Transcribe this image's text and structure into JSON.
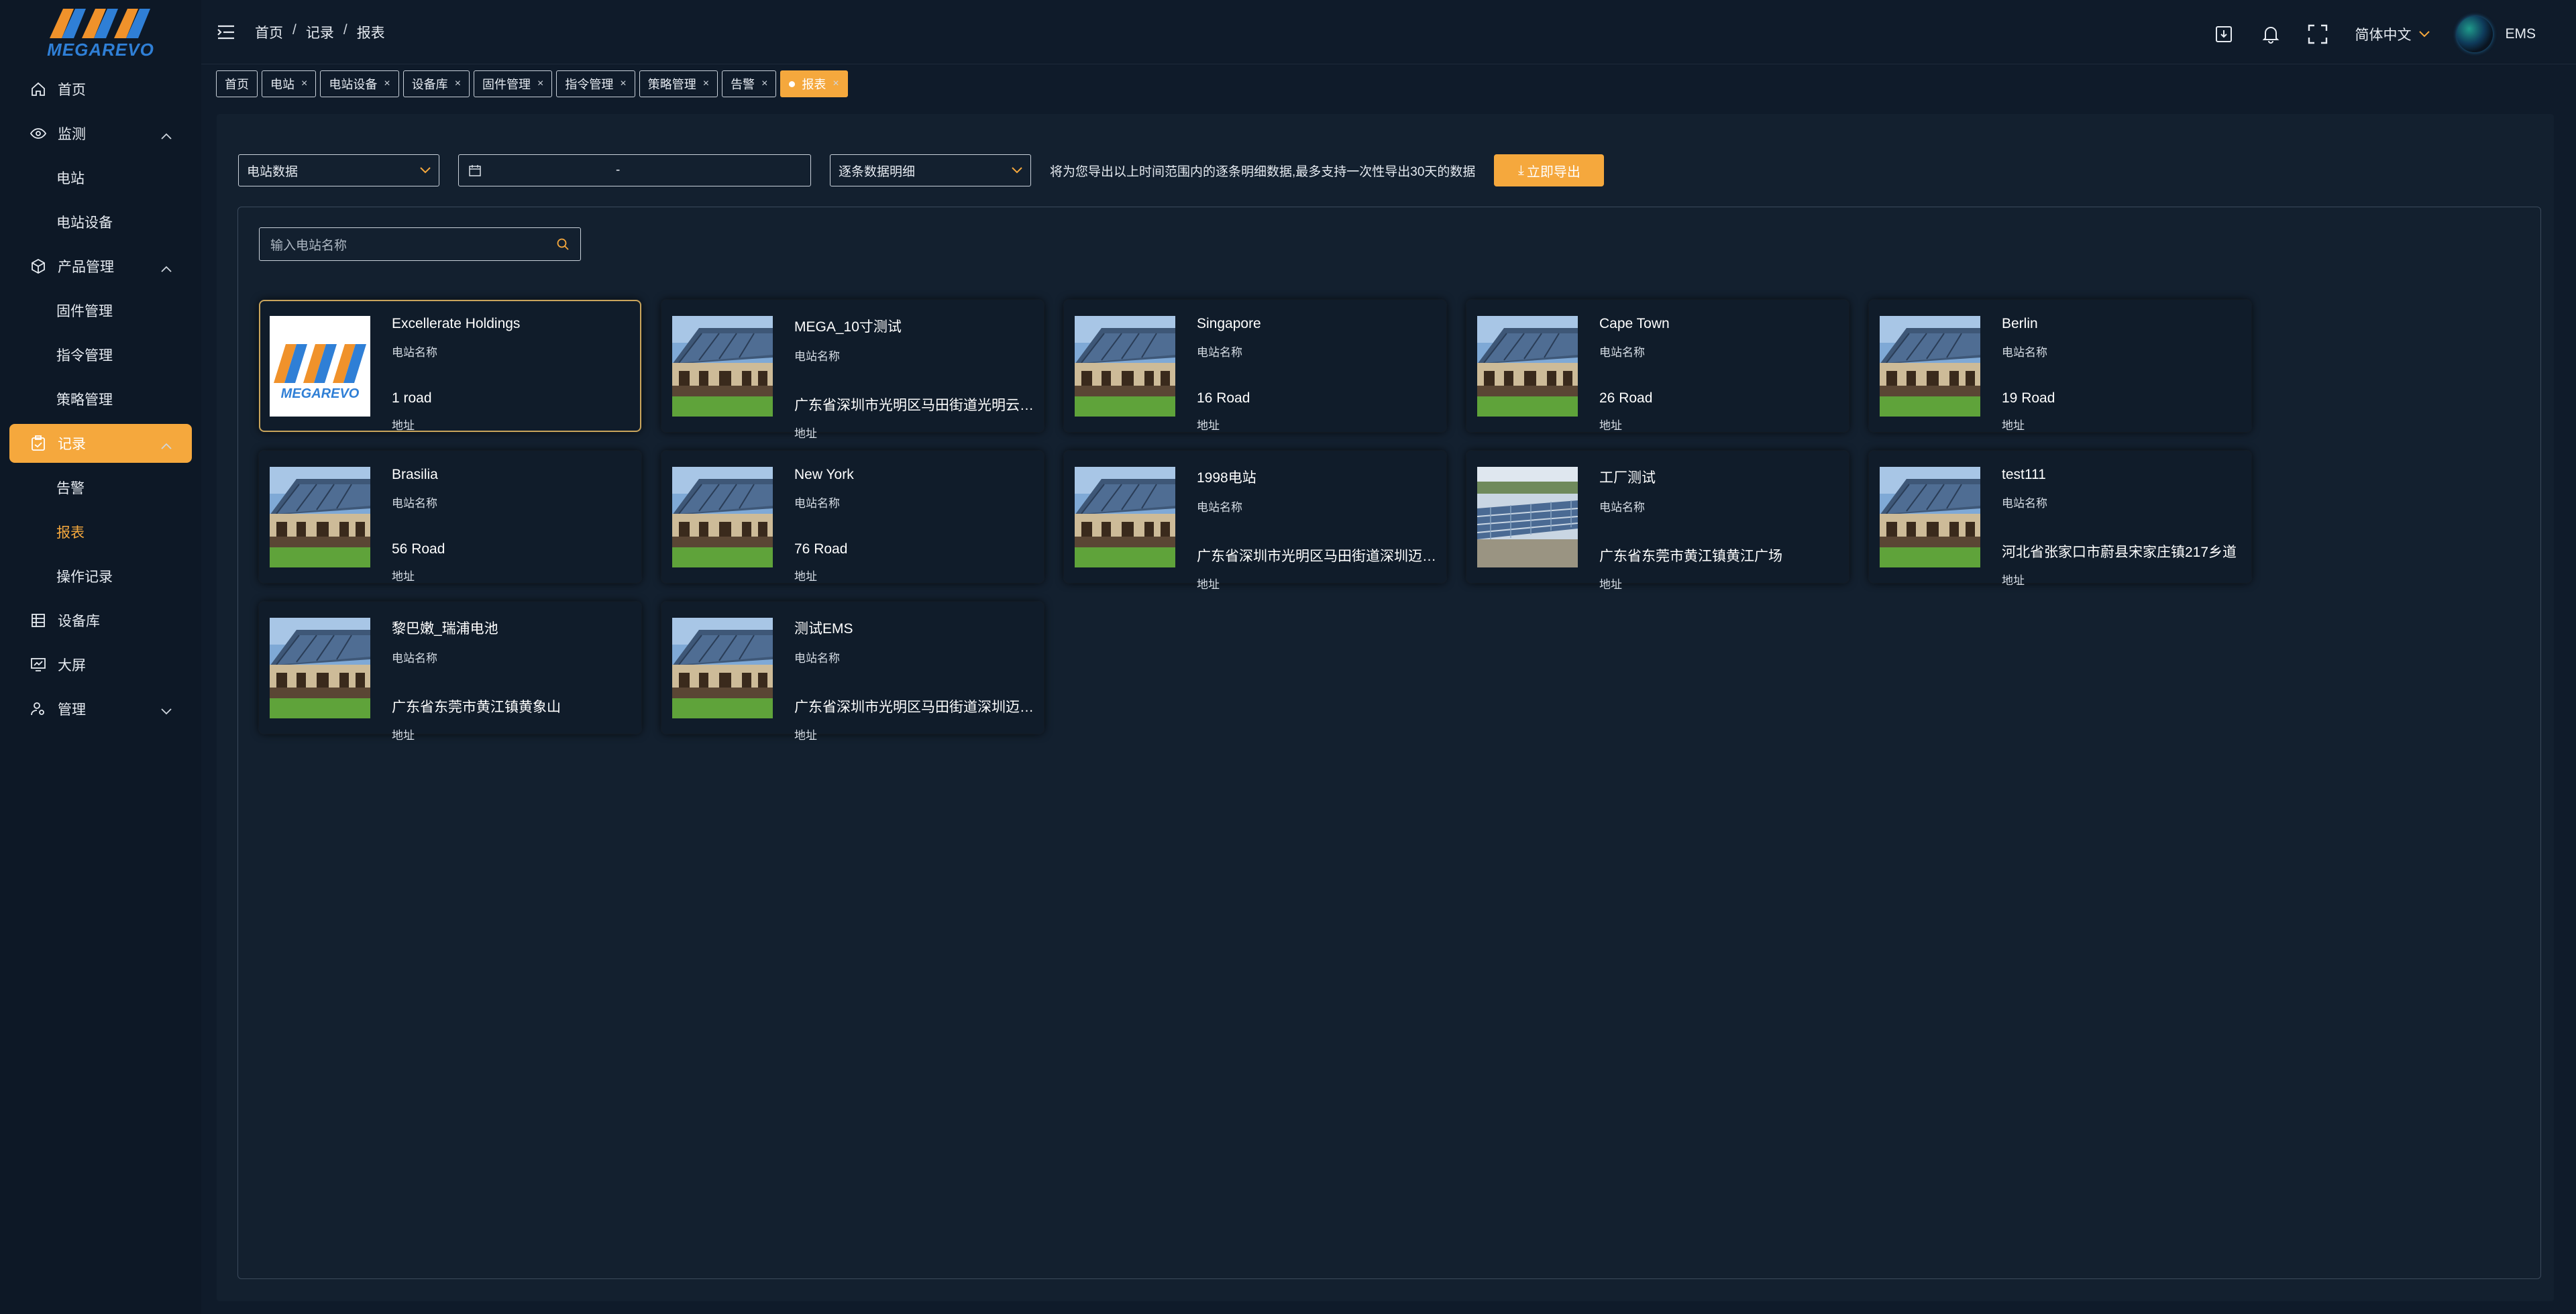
{
  "brand": {
    "name": "MEGAREVO"
  },
  "sidebar": {
    "items": [
      {
        "label": "首页",
        "icon": "home-icon"
      },
      {
        "label": "监测",
        "icon": "eye-icon",
        "expanded": true
      },
      {
        "label": "电站",
        "sub": true
      },
      {
        "label": "电站设备",
        "sub": true
      },
      {
        "label": "产品管理",
        "icon": "cube-icon",
        "expanded": true
      },
      {
        "label": "固件管理",
        "sub": true
      },
      {
        "label": "指令管理",
        "sub": true
      },
      {
        "label": "策略管理",
        "sub": true
      },
      {
        "label": "记录",
        "icon": "clipboard-icon",
        "expanded": true,
        "active": true
      },
      {
        "label": "告警",
        "sub": true
      },
      {
        "label": "报表",
        "sub": true,
        "active": true
      },
      {
        "label": "操作记录",
        "sub": true
      },
      {
        "label": "设备库",
        "icon": "list-icon"
      },
      {
        "label": "大屏",
        "icon": "monitor-icon"
      },
      {
        "label": "管理",
        "icon": "user-settings-icon",
        "expanded": false
      }
    ]
  },
  "header": {
    "breadcrumb": [
      "首页",
      "记录",
      "报表"
    ],
    "separator": "/",
    "language": "简体中文",
    "username": "EMS"
  },
  "tabs": [
    {
      "label": "首页",
      "closable": false
    },
    {
      "label": "电站",
      "closable": true
    },
    {
      "label": "电站设备",
      "closable": true
    },
    {
      "label": "设备库",
      "closable": true
    },
    {
      "label": "固件管理",
      "closable": true
    },
    {
      "label": "指令管理",
      "closable": true
    },
    {
      "label": "策略管理",
      "closable": true
    },
    {
      "label": "告警",
      "closable": true
    },
    {
      "label": "报表",
      "closable": true,
      "active": true
    }
  ],
  "filters": {
    "data_type": "电站数据",
    "date_separator": "-",
    "detail_type": "逐条数据明细",
    "hint": "将为您导出以上时间范围内的逐条明细数据,最多支持一次性导出30天的数据",
    "export_label": "立即导出"
  },
  "search": {
    "placeholder": "输入电站名称"
  },
  "stations": [
    {
      "name": "Excellerate Holdings",
      "name_label": "电站名称",
      "address": "1 road",
      "address_label": "地址",
      "image": "logo",
      "selected": true
    },
    {
      "name": "MEGA_10寸测试",
      "name_label": "电站名称",
      "address": "广东省深圳市光明区马田街道光明云…",
      "address_label": "地址",
      "image": "house"
    },
    {
      "name": "Singapore",
      "name_label": "电站名称",
      "address": "16 Road",
      "address_label": "地址",
      "image": "house"
    },
    {
      "name": "Cape Town",
      "name_label": "电站名称",
      "address": "26 Road",
      "address_label": "地址",
      "image": "house"
    },
    {
      "name": "Berlin",
      "name_label": "电站名称",
      "address": "19 Road",
      "address_label": "地址",
      "image": "house"
    },
    {
      "name": "Brasilia",
      "name_label": "电站名称",
      "address": "56 Road",
      "address_label": "地址",
      "image": "house"
    },
    {
      "name": "New York",
      "name_label": "电站名称",
      "address": "76 Road",
      "address_label": "地址",
      "image": "house"
    },
    {
      "name": "1998电站",
      "name_label": "电站名称",
      "address": "广东省深圳市光明区马田街道深圳迈…",
      "address_label": "地址",
      "image": "house"
    },
    {
      "name": "工厂测试",
      "name_label": "电站名称",
      "address": "广东省东莞市黄江镇黄江广场",
      "address_label": "地址",
      "image": "field"
    },
    {
      "name": "test111",
      "name_label": "电站名称",
      "address": "河北省张家口市蔚县宋家庄镇217乡道",
      "address_label": "地址",
      "image": "house"
    },
    {
      "name": "黎巴嫩_瑞浦电池",
      "name_label": "电站名称",
      "address": "广东省东莞市黄江镇黄象山",
      "address_label": "地址",
      "image": "house"
    },
    {
      "name": "测试EMS",
      "name_label": "电站名称",
      "address": "广东省深圳市光明区马田街道深圳迈…",
      "address_label": "地址",
      "image": "house"
    }
  ],
  "colors": {
    "accent": "#f5a83d",
    "background": "#0f1b2a",
    "panel": "#13202f",
    "card": "#101c2a"
  }
}
